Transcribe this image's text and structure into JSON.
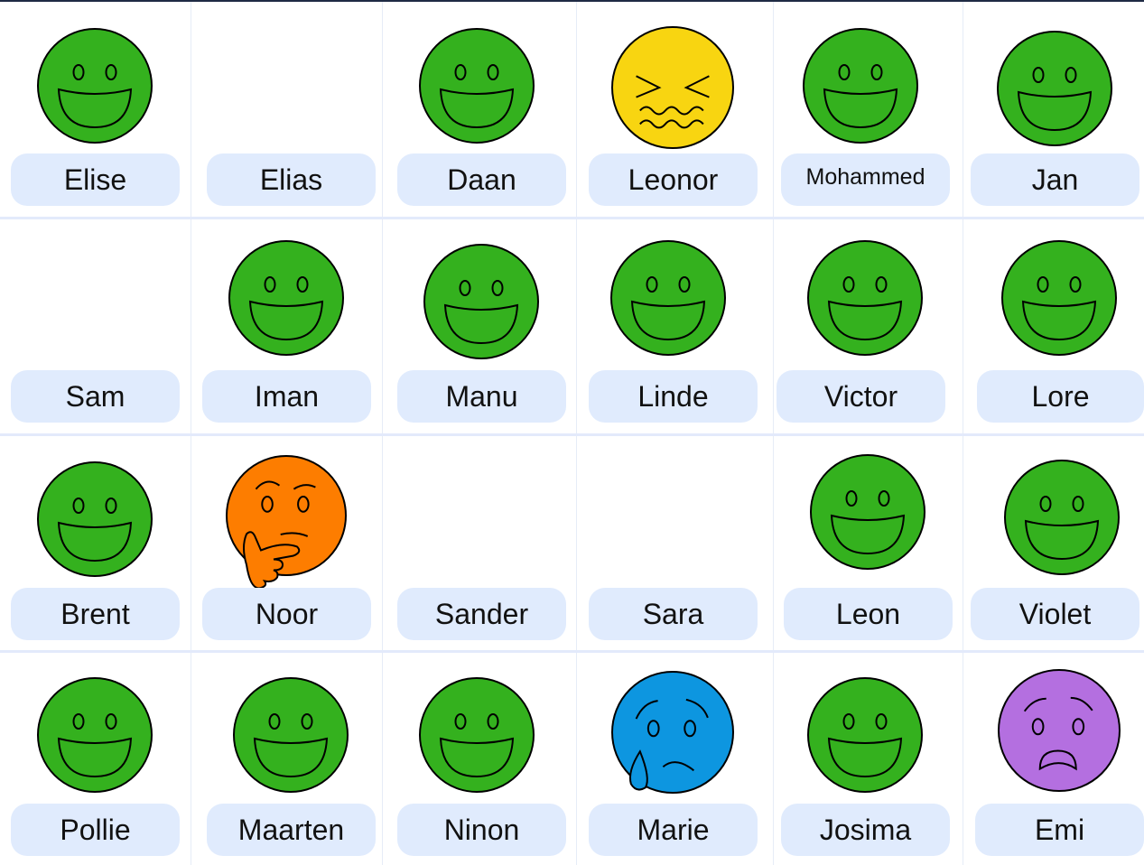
{
  "students": [
    {
      "name": "Elise",
      "mood": "happy"
    },
    {
      "name": "Elias",
      "mood": "none"
    },
    {
      "name": "Daan",
      "mood": "happy"
    },
    {
      "name": "Leonor",
      "mood": "confounded"
    },
    {
      "name": "Mohammed",
      "mood": "happy"
    },
    {
      "name": "Jan",
      "mood": "happy"
    },
    {
      "name": "Sam",
      "mood": "none"
    },
    {
      "name": "Iman",
      "mood": "happy"
    },
    {
      "name": "Manu",
      "mood": "happy"
    },
    {
      "name": "Linde",
      "mood": "happy"
    },
    {
      "name": "Victor",
      "mood": "happy"
    },
    {
      "name": "Lore",
      "mood": "happy"
    },
    {
      "name": "Brent",
      "mood": "happy"
    },
    {
      "name": "Noor",
      "mood": "thinking"
    },
    {
      "name": "Sander",
      "mood": "none"
    },
    {
      "name": "Sara",
      "mood": "none"
    },
    {
      "name": "Leon",
      "mood": "happy"
    },
    {
      "name": "Violet",
      "mood": "happy"
    },
    {
      "name": "Pollie",
      "mood": "happy"
    },
    {
      "name": "Maarten",
      "mood": "happy"
    },
    {
      "name": "Ninon",
      "mood": "happy"
    },
    {
      "name": "Marie",
      "mood": "sad-tear"
    },
    {
      "name": "Josima",
      "mood": "happy"
    },
    {
      "name": "Emi",
      "mood": "anxious"
    }
  ],
  "colors": {
    "happy": "#34b11e",
    "confounded": "#f8d511",
    "thinking": "#fd7d00",
    "sad-tear": "#0d96e0",
    "anxious": "#b46fe0",
    "name_tag": "#e0ebfd",
    "grid_line": "#e6ecf7"
  }
}
